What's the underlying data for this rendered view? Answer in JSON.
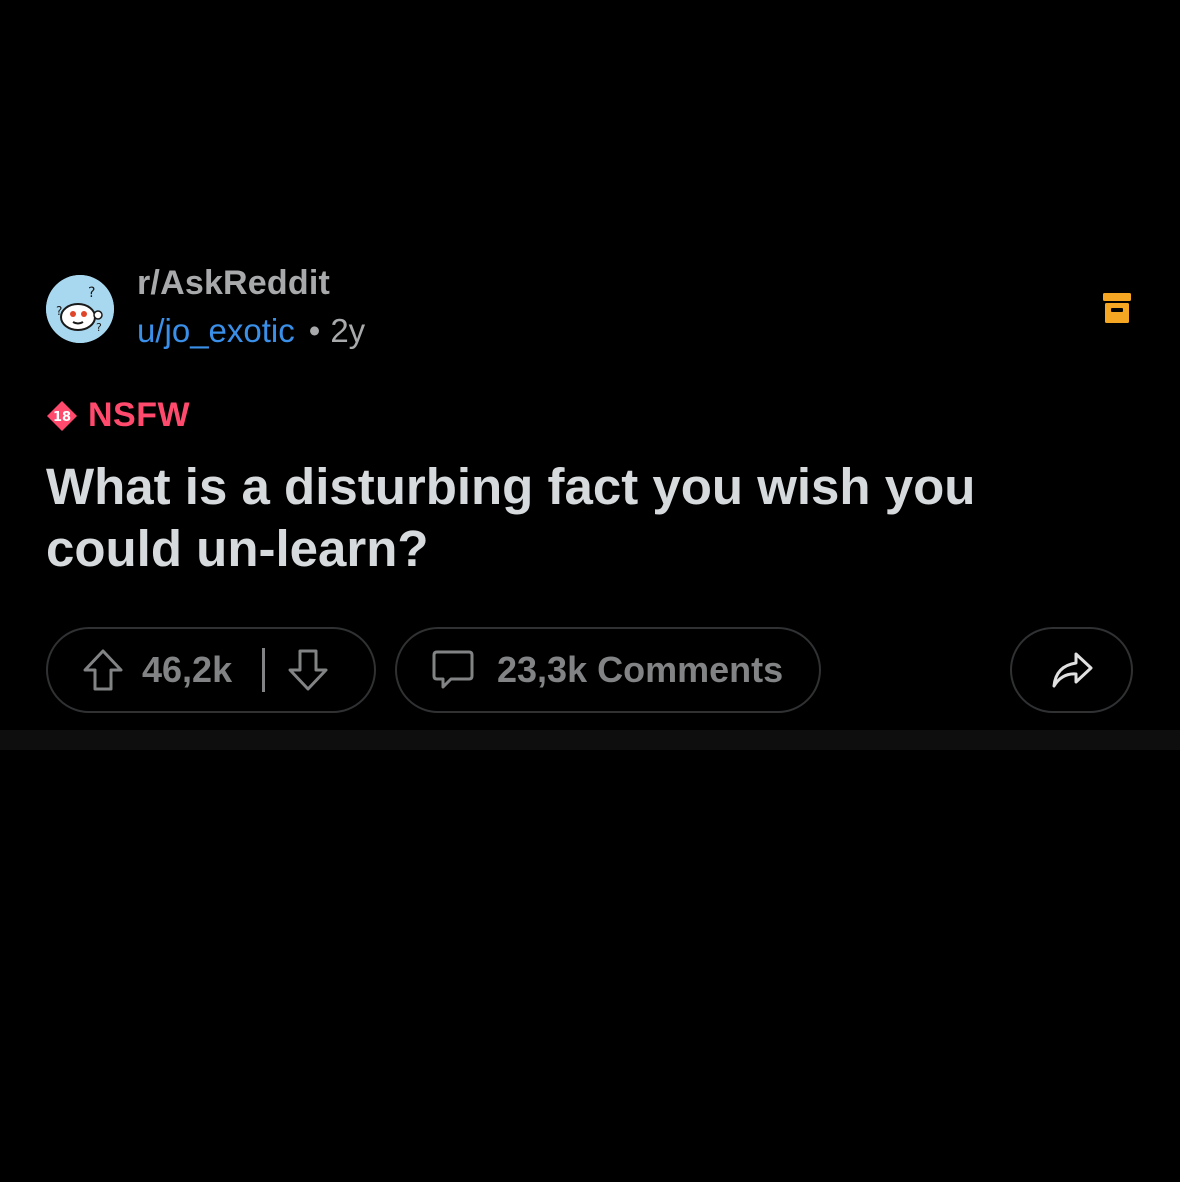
{
  "post": {
    "subreddit": "r/AskReddit",
    "username": "u/jo_exotic",
    "separator": "•",
    "age": "2y",
    "nsfw_label": "NSFW",
    "nsfw_badge_text": "18",
    "title": "What is a disturbing fact you wish you could un-learn?"
  },
  "actions": {
    "upvote_count": "46,2k",
    "comments_label": "23,3k Comments"
  },
  "icons": {
    "avatar": "subreddit-avatar-icon",
    "archive": "archive-icon",
    "upvote": "upvote-arrow-icon",
    "downvote": "downvote-arrow-icon",
    "comment": "comment-bubble-icon",
    "share": "share-arrow-icon"
  },
  "colors": {
    "background": "#000000",
    "username": "#3a8fe8",
    "nsfw": "#ff4a6e",
    "archive": "#f5a623",
    "muted": "#818384",
    "title": "#d7dadc"
  }
}
